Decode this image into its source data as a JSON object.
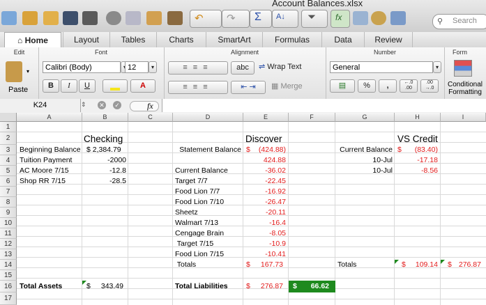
{
  "window": {
    "title": "Account Balances.xlsx"
  },
  "search": {
    "placeholder": "Search"
  },
  "ribbon_tabs": [
    "Home",
    "Layout",
    "Tables",
    "Charts",
    "SmartArt",
    "Formulas",
    "Data",
    "Review"
  ],
  "groups": {
    "edit": "Edit",
    "font": "Font",
    "alignment": "Alignment",
    "number": "Number",
    "format": "Form"
  },
  "edit": {
    "paste": "Paste"
  },
  "font": {
    "name": "Calibri (Body)",
    "size": "12",
    "bold": "B",
    "italic": "I",
    "underline": "U"
  },
  "alignment": {
    "abc": "abc",
    "wrap_text": "Wrap Text",
    "merge": "Merge"
  },
  "number": {
    "format": "General",
    "percent": "%",
    "comma": ",",
    "inc_decimal": "←.0\n.00",
    "dec_decimal": ".00\n→.0"
  },
  "format": {
    "conditional_line1": "Conditional",
    "conditional_line2": "Formatting"
  },
  "formula_bar": {
    "cell_ref": "K24",
    "fx": "fx"
  },
  "colors": {
    "ribbon_active": "#ffffff",
    "negative": "#e21b1b",
    "selected_fill": "#1e8a1e",
    "formula_flag": "#1e8a1e"
  },
  "columns": [
    "A",
    "B",
    "C",
    "D",
    "E",
    "F",
    "G",
    "H",
    "I"
  ],
  "rows": [
    "1",
    "2",
    "3",
    "4",
    "5",
    "6",
    "7",
    "8",
    "9",
    "10",
    "11",
    "12",
    "13",
    "14",
    "15",
    "16",
    "17"
  ],
  "cells": {
    "B2": "Checking",
    "E2": "Discover",
    "H2": "VS Credit",
    "A3": "Beginning Balance",
    "B3": "$ 2,384.79",
    "D3": "Statement Balance",
    "E3_sym": "$",
    "E3": "(424.88)",
    "G3": "Current Balance",
    "H3_sym": "$",
    "H3": "(83.40)",
    "A4": "Tuition Payment",
    "B4": "-2000",
    "E4": "424.88",
    "G4": "10-Jul",
    "H4": "-17.18",
    "A5": "AC Moore 7/15",
    "B5": "-12.8",
    "D5": "Current Balance",
    "E5": "-36.02",
    "G5": "10-Jul",
    "H5": "-8.56",
    "A6": "Shop RR 7/15",
    "B6": "-28.5",
    "D6": "Target 7/7",
    "E6": "-22.45",
    "D7": "Food Lion 7/7",
    "E7": "-16.92",
    "D8": "Food Lion 7/10",
    "E8": "-26.47",
    "D9": "Sheetz",
    "E9": "-20.11",
    "D10": "Walmart 7/13",
    "E10": "-16.4",
    "D11": "Cengage Brain",
    "E11": "-8.05",
    "D12": " Target 7/15",
    "E12": "-10.9",
    "D13": "Food Lion 7/15",
    "E13": "-10.41",
    "D14": " Totals",
    "E14_sym": "$",
    "E14": "167.73",
    "G14": "Totals",
    "H14_sym": "$",
    "H14": "109.14",
    "I14_sym": "$",
    "I14": "276.87",
    "A16": "Total Assets",
    "B16_sym": "$",
    "B16": "343.49",
    "D16": "Total Liabilities",
    "E16_sym": "$",
    "E16": "276.87",
    "F16_sym": "$",
    "F16": "66.62"
  }
}
